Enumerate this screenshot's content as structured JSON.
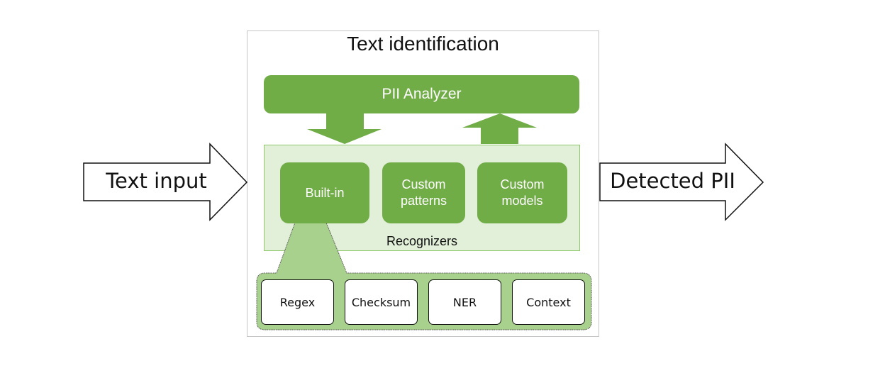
{
  "diagram": {
    "title": "Text identification",
    "input_arrow": {
      "label": "Text input"
    },
    "output_arrow": {
      "label": "Detected PII"
    },
    "analyzer": {
      "label": "PII Analyzer"
    },
    "recognizers": {
      "label": "Recognizers",
      "items": [
        {
          "label": "Built-in"
        },
        {
          "label": "Custom patterns",
          "line1": "Custom",
          "line2": "patterns"
        },
        {
          "label": "Custom models",
          "line1": "Custom",
          "line2": "models"
        }
      ]
    },
    "builtin_techniques": [
      {
        "label": "Regex"
      },
      {
        "label": "Checksum"
      },
      {
        "label": "NER"
      },
      {
        "label": "Context"
      }
    ],
    "colors": {
      "primary_green": "#70ad47",
      "light_green_fill": "#e2f0d9",
      "callout_green": "#a9d18e",
      "outline": "#111111"
    }
  }
}
